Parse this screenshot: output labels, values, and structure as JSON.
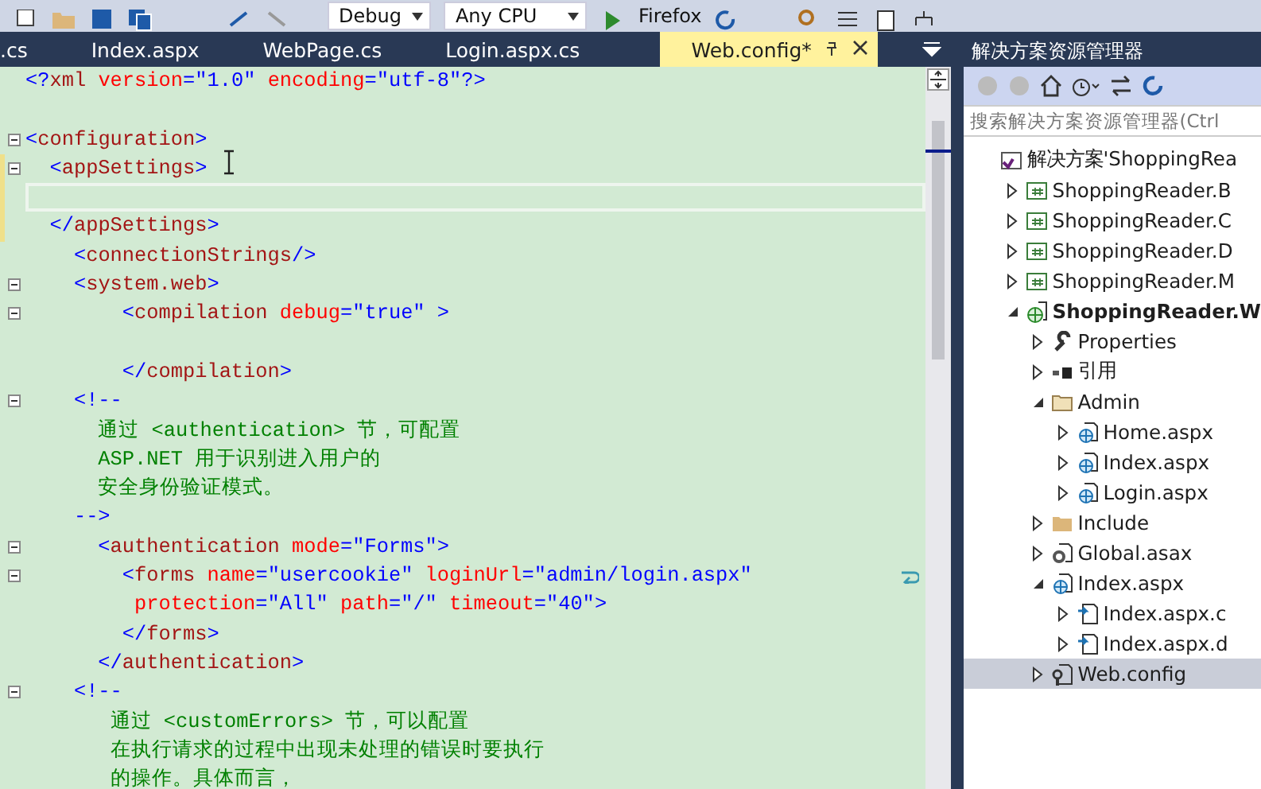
{
  "toolbar": {
    "items": [
      {
        "kind": "combo",
        "text": "Debug"
      },
      {
        "kind": "combo",
        "text": "Any CPU"
      },
      {
        "kind": "run",
        "text": "Firefox"
      }
    ]
  },
  "tabs": [
    {
      "label": ".cs",
      "selected": false
    },
    {
      "label": "Index.aspx",
      "selected": false
    },
    {
      "label": "WebPage.cs",
      "selected": false
    },
    {
      "label": "Login.aspx.cs",
      "selected": false
    },
    {
      "label": "Web.config*",
      "selected": true
    }
  ],
  "editor": {
    "lines": [
      {
        "fold": false,
        "current": false,
        "changed": false,
        "wrapped": false,
        "tokens": [
          {
            "kind": "punct",
            "text": "<?"
          },
          {
            "kind": "name",
            "text": "xml"
          },
          {
            "kind": "attr",
            "text": " version"
          },
          {
            "kind": "punct",
            "text": "="
          },
          {
            "kind": "value",
            "text": "\"1.0\""
          },
          {
            "kind": "attr",
            "text": " encoding"
          },
          {
            "kind": "punct",
            "text": "="
          },
          {
            "kind": "value",
            "text": "\"utf-8\""
          },
          {
            "kind": "punct",
            "text": "?>"
          }
        ]
      },
      {
        "fold": false,
        "current": false,
        "changed": false,
        "wrapped": false
      },
      {
        "fold": true,
        "current": false,
        "changed": false,
        "wrapped": false,
        "tokens": [
          {
            "kind": "punct",
            "text": "<"
          },
          {
            "kind": "name",
            "text": "configuration"
          },
          {
            "kind": "punct",
            "text": ">"
          }
        ]
      },
      {
        "fold": true,
        "current": false,
        "changed": true,
        "wrapped": false,
        "tokens": [
          {
            "kind": "punct",
            "text": "  <"
          },
          {
            "kind": "name",
            "text": "appSettings"
          },
          {
            "kind": "punct",
            "text": ">"
          }
        ]
      },
      {
        "fold": false,
        "current": true,
        "changed": true,
        "wrapped": false
      },
      {
        "fold": false,
        "current": false,
        "changed": true,
        "wrapped": false,
        "tokens": [
          {
            "kind": "punct",
            "text": "  </"
          },
          {
            "kind": "name",
            "text": "appSettings"
          },
          {
            "kind": "punct",
            "text": ">"
          }
        ]
      },
      {
        "fold": false,
        "current": false,
        "changed": false,
        "wrapped": false,
        "tokens": [
          {
            "kind": "punct",
            "text": "    <"
          },
          {
            "kind": "name",
            "text": "connectionStrings"
          },
          {
            "kind": "punct",
            "text": "/>"
          }
        ]
      },
      {
        "fold": true,
        "current": false,
        "changed": false,
        "wrapped": false,
        "tokens": [
          {
            "kind": "punct",
            "text": "    <"
          },
          {
            "kind": "name",
            "text": "system.web"
          },
          {
            "kind": "punct",
            "text": ">"
          }
        ]
      },
      {
        "fold": true,
        "current": false,
        "changed": false,
        "wrapped": false,
        "tokens": [
          {
            "kind": "punct",
            "text": "        <"
          },
          {
            "kind": "name",
            "text": "compilation"
          },
          {
            "kind": "attr",
            "text": " debug"
          },
          {
            "kind": "punct",
            "text": "="
          },
          {
            "kind": "value",
            "text": "\"true\""
          },
          {
            "kind": "punct",
            "text": " >"
          }
        ]
      },
      {
        "fold": false,
        "current": false,
        "changed": false,
        "wrapped": false
      },
      {
        "fold": false,
        "current": false,
        "changed": false,
        "wrapped": false,
        "tokens": [
          {
            "kind": "punct",
            "text": "        </"
          },
          {
            "kind": "name",
            "text": "compilation"
          },
          {
            "kind": "punct",
            "text": ">"
          }
        ]
      },
      {
        "fold": true,
        "current": false,
        "changed": false,
        "wrapped": false,
        "tokens": [
          {
            "kind": "punct",
            "text": "    <!--"
          }
        ]
      },
      {
        "fold": false,
        "current": false,
        "changed": false,
        "wrapped": false,
        "tokens": [
          {
            "kind": "comment",
            "text": "      通过 <authentication> 节，可配置"
          }
        ]
      },
      {
        "fold": false,
        "current": false,
        "changed": false,
        "wrapped": false,
        "tokens": [
          {
            "kind": "comment",
            "text": "      ASP.NET 用于识别进入用户的"
          }
        ]
      },
      {
        "fold": false,
        "current": false,
        "changed": false,
        "wrapped": false,
        "tokens": [
          {
            "kind": "comment",
            "text": "      安全身份验证模式。"
          }
        ]
      },
      {
        "fold": false,
        "current": false,
        "changed": false,
        "wrapped": false,
        "tokens": [
          {
            "kind": "punct",
            "text": "    -->"
          }
        ]
      },
      {
        "fold": true,
        "current": false,
        "changed": false,
        "wrapped": false,
        "tokens": [
          {
            "kind": "punct",
            "text": "      <"
          },
          {
            "kind": "name",
            "text": "authentication"
          },
          {
            "kind": "attr",
            "text": " mode"
          },
          {
            "kind": "punct",
            "text": "="
          },
          {
            "kind": "value",
            "text": "\"Forms\""
          },
          {
            "kind": "punct",
            "text": ">"
          }
        ]
      },
      {
        "fold": true,
        "current": false,
        "changed": false,
        "wrapped": true,
        "tokens": [
          {
            "kind": "punct",
            "text": "        <"
          },
          {
            "kind": "name",
            "text": "forms"
          },
          {
            "kind": "attr",
            "text": " name"
          },
          {
            "kind": "punct",
            "text": "="
          },
          {
            "kind": "value",
            "text": "\"usercookie\""
          },
          {
            "kind": "attr",
            "text": " loginUrl"
          },
          {
            "kind": "punct",
            "text": "="
          },
          {
            "kind": "value",
            "text": "\"admin/login.aspx\""
          }
        ]
      },
      {
        "fold": false,
        "current": false,
        "changed": false,
        "wrapped": false,
        "tokens": [
          {
            "kind": "attr",
            "text": "         protection"
          },
          {
            "kind": "punct",
            "text": "="
          },
          {
            "kind": "value",
            "text": "\"All\""
          },
          {
            "kind": "attr",
            "text": " path"
          },
          {
            "kind": "punct",
            "text": "="
          },
          {
            "kind": "value",
            "text": "\"/\""
          },
          {
            "kind": "attr",
            "text": " timeout"
          },
          {
            "kind": "punct",
            "text": "="
          },
          {
            "kind": "value",
            "text": "\"40\""
          },
          {
            "kind": "punct",
            "text": ">"
          }
        ]
      },
      {
        "fold": false,
        "current": false,
        "changed": false,
        "wrapped": false,
        "tokens": [
          {
            "kind": "punct",
            "text": "        </"
          },
          {
            "kind": "name",
            "text": "forms"
          },
          {
            "kind": "punct",
            "text": ">"
          }
        ]
      },
      {
        "fold": false,
        "current": false,
        "changed": false,
        "wrapped": false,
        "tokens": [
          {
            "kind": "punct",
            "text": "      </"
          },
          {
            "kind": "name",
            "text": "authentication"
          },
          {
            "kind": "punct",
            "text": ">"
          }
        ]
      },
      {
        "fold": true,
        "current": false,
        "changed": false,
        "wrapped": false,
        "tokens": [
          {
            "kind": "punct",
            "text": "    <!--"
          }
        ]
      },
      {
        "fold": false,
        "current": false,
        "changed": false,
        "wrapped": false,
        "tokens": [
          {
            "kind": "comment",
            "text": "       通过 <customErrors> 节，可以配置"
          }
        ]
      },
      {
        "fold": false,
        "current": false,
        "changed": false,
        "wrapped": false,
        "tokens": [
          {
            "kind": "comment",
            "text": "       在执行请求的过程中出现未处理的错误时要执行"
          }
        ]
      },
      {
        "fold": false,
        "current": false,
        "changed": false,
        "wrapped": false,
        "tokens": [
          {
            "kind": "comment",
            "text": "       的操作。具体而言，"
          }
        ]
      }
    ]
  },
  "solution_explorer": {
    "title": "解决方案资源管理器",
    "search": {
      "placeholder": "搜索解决方案资源管理器(Ctrl"
    },
    "tree": [
      {
        "label": "解决方案'ShoppingRea",
        "kind": "solution",
        "selected": false,
        "children": [
          {
            "label": "ShoppingReader.B",
            "kind": "project",
            "expanded": false,
            "selected": false,
            "startup": false
          },
          {
            "label": "ShoppingReader.C",
            "kind": "project",
            "expanded": false,
            "selected": false,
            "startup": false
          },
          {
            "label": "ShoppingReader.D",
            "kind": "project",
            "expanded": false,
            "selected": false,
            "startup": false
          },
          {
            "label": "ShoppingReader.M",
            "kind": "project",
            "expanded": false,
            "selected": false,
            "startup": false
          },
          {
            "label": "ShoppingReader.W",
            "kind": "website",
            "expanded": true,
            "selected": false,
            "startup": true,
            "children": [
              {
                "label": "Properties",
                "kind": "properties",
                "expanded": false,
                "selected": false
              },
              {
                "label": "引用",
                "kind": "references",
                "expanded": false,
                "selected": false
              },
              {
                "label": "Admin",
                "kind": "folder",
                "expanded": true,
                "selected": false,
                "children": [
                  {
                    "label": "Home.aspx",
                    "kind": "page",
                    "expanded": false,
                    "selected": false
                  },
                  {
                    "label": "Index.aspx",
                    "kind": "page",
                    "expanded": false,
                    "selected": false
                  },
                  {
                    "label": "Login.aspx",
                    "kind": "page",
                    "expanded": false,
                    "selected": false
                  }
                ]
              },
              {
                "label": "Include",
                "kind": "folder",
                "expanded": false,
                "selected": false
              },
              {
                "label": "Global.asax",
                "kind": "global",
                "expanded": false,
                "selected": false
              },
              {
                "label": "Index.aspx",
                "kind": "page",
                "expanded": true,
                "selected": false,
                "children": [
                  {
                    "label": "Index.aspx.c",
                    "kind": "codebehind",
                    "expanded": false,
                    "selected": false
                  },
                  {
                    "label": "Index.aspx.d",
                    "kind": "codebehind",
                    "expanded": false,
                    "selected": false
                  }
                ]
              },
              {
                "label": "Web.config",
                "kind": "config",
                "expanded": false,
                "selected": true
              }
            ]
          }
        ]
      }
    ]
  }
}
